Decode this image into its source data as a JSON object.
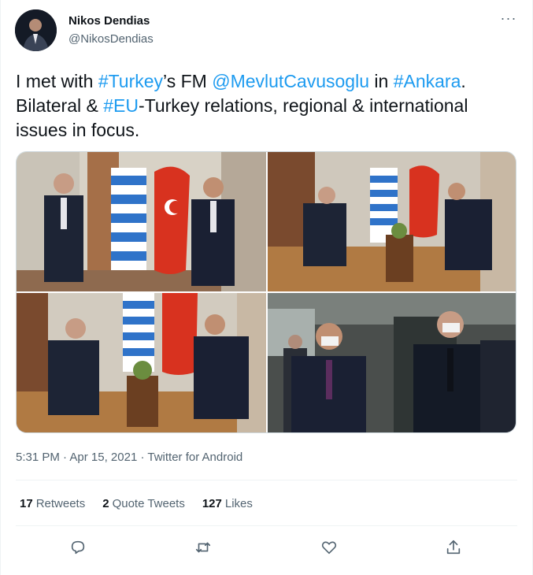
{
  "author": {
    "name": "Nikos Dendias",
    "handle": "@NikosDendias"
  },
  "tweet": {
    "parts": [
      {
        "text": "I met with ",
        "type": "text"
      },
      {
        "text": "#Turkey",
        "type": "link"
      },
      {
        "text": "’s FM ",
        "type": "text"
      },
      {
        "text": "@MevlutCavusoglu",
        "type": "link"
      },
      {
        "text": " in ",
        "type": "text"
      },
      {
        "text": "#Ankara",
        "type": "link"
      },
      {
        "text": ". Bilateral & ",
        "type": "text"
      },
      {
        "text": "#EU",
        "type": "link"
      },
      {
        "text": "-Turkey relations, regional & international issues in focus.",
        "type": "text"
      }
    ]
  },
  "meta": {
    "time": "5:31 PM",
    "separator1": " · ",
    "date": "Apr 15, 2021",
    "separator2": " · ",
    "source": "Twitter for Android"
  },
  "stats": {
    "retweets_count": "17",
    "retweets_label": "Retweets",
    "quotes_count": "2",
    "quotes_label": "Quote Tweets",
    "likes_count": "127",
    "likes_label": "Likes"
  },
  "icons": {
    "more": "more-horizontal-icon",
    "reply": "reply-icon",
    "retweet": "retweet-icon",
    "like": "heart-icon",
    "share": "share-icon"
  },
  "colors": {
    "link": "#1d9bf0",
    "text": "#0f1419",
    "secondary": "#536471",
    "border": "#eff3f4"
  }
}
